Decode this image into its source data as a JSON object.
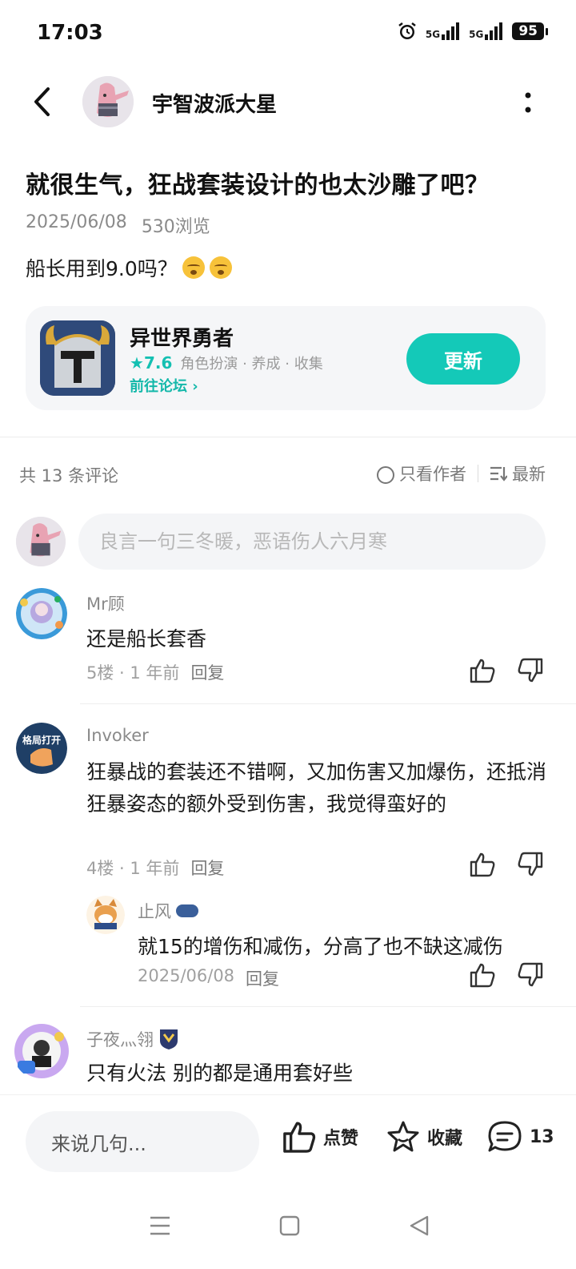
{
  "status_bar": {
    "time": "17:03",
    "network_1": "5G",
    "network_2": "5G",
    "battery": "95"
  },
  "header": {
    "author_name": "宇智波派大星"
  },
  "post": {
    "title": "就很生气，狂战套装设计的也太沙雕了吧？",
    "date": "2025/06/08",
    "views": "530浏览",
    "body": "船长用到9.0吗？"
  },
  "game_card": {
    "name": "异世界勇者",
    "rating": "7.6",
    "tags": "角色扮演 · 养成 · 收集",
    "forum_link": "前往论坛",
    "button": "更新"
  },
  "comments_header": {
    "count": "共 13 条评论",
    "only_author": "只看作者",
    "sort": "最新"
  },
  "comment_input": {
    "placeholder": "良言一句三冬暖，恶语伤人六月寒"
  },
  "comments": [
    {
      "name": "Mr顾",
      "text": "还是船长套香",
      "floor": "5楼 · 1 年前",
      "reply": "回复"
    },
    {
      "name": "Invoker",
      "avatar_label": "格局打开",
      "text": "狂暴战的套装还不错啊，又加伤害又加爆伤，还抵消狂暴姿态的额外受到伤害，我觉得蛮好的",
      "floor": "4楼 · 1 年前",
      "reply": "回复"
    },
    {
      "name": "子夜灬翎",
      "text": "只有火法 别的都是通用套好些"
    }
  ],
  "sub_reply": {
    "name": "止风",
    "text": "就15的增伤和减伤，分高了也不缺这减伤",
    "date": "2025/06/08",
    "reply": "回复"
  },
  "bottom_bar": {
    "input_label": "来说几句...",
    "like": "点赞",
    "favorite": "收藏",
    "comment_count": "13"
  },
  "colors": {
    "accent": "#14c9b8",
    "text_primary": "#1a1a1a",
    "text_secondary": "#8a8a8a"
  }
}
